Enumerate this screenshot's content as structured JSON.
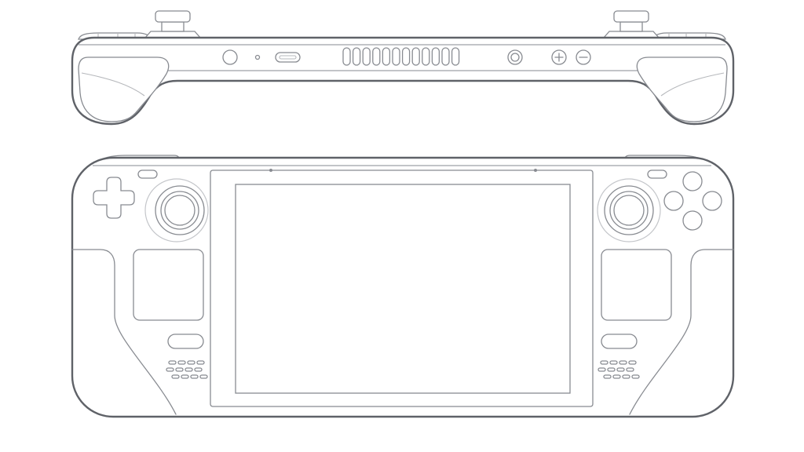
{
  "palette": {
    "background": "#ffffff",
    "outline": "#5f6268",
    "detail": "#888b91",
    "faint": "#c4c6ca"
  },
  "views": [
    {
      "id": "top-view",
      "icons": [
        "power-button-icon",
        "microphone-icon",
        "usb-c-port-icon",
        "vent-icon",
        "headphone-jack-icon",
        "volume-up-icon",
        "volume-down-icon"
      ]
    },
    {
      "id": "front-view",
      "icons": [
        "dpad-icon",
        "joystick-icon",
        "trackpad-icon",
        "menu-button-icon",
        "abxy-buttons-icon",
        "speaker-grille-icon"
      ]
    }
  ]
}
